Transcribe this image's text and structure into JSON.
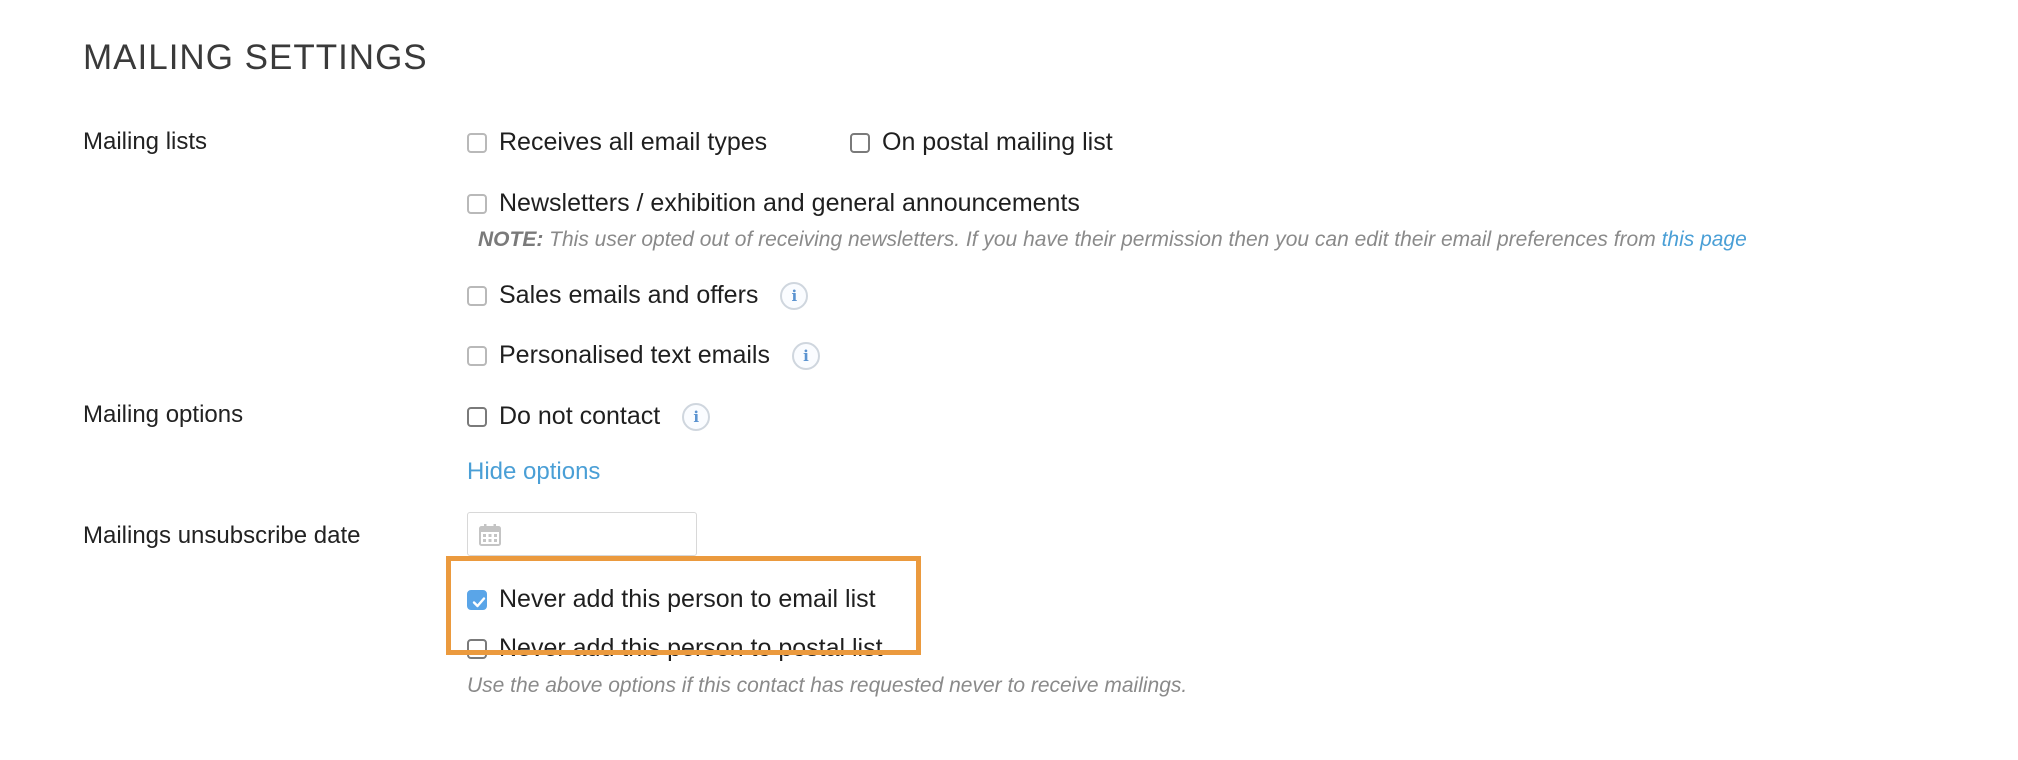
{
  "section_title": "MAILING SETTINGS",
  "mailing_lists": {
    "label": "Mailing lists",
    "receives_all": {
      "label": "Receives all email types",
      "checked": false
    },
    "postal": {
      "label": "On postal mailing list",
      "checked": false
    },
    "newsletters": {
      "label": "Newsletters / exhibition and general announcements",
      "checked": false
    },
    "note": {
      "prefix": "NOTE:",
      "text": " This user opted out of receiving newsletters. If you have their permission then you can edit their email preferences from ",
      "link": "this page"
    },
    "sales": {
      "label": "Sales emails and offers",
      "checked": false,
      "info_icon": "info-icon"
    },
    "personalised": {
      "label": "Personalised text emails",
      "checked": false,
      "info_icon": "info-icon"
    }
  },
  "mailing_options": {
    "label": "Mailing options",
    "do_not_contact": {
      "label": "Do not contact",
      "checked": false,
      "info_icon": "info-icon"
    },
    "hide_options": "Hide options"
  },
  "unsubscribe": {
    "label": "Mailings unsubscribe date",
    "date_value": "",
    "calendar_icon": "calendar-icon",
    "never_email": {
      "label": "Never add this person to email list",
      "checked": true
    },
    "never_postal": {
      "label": "Never add this person to postal list",
      "checked": false
    },
    "help": "Use the above options if this contact has requested never to receive mailings."
  },
  "colors": {
    "accent_link": "#4a9fd6",
    "highlight": "#eb9a3e",
    "checkbox_checked": "#5aa5e8"
  }
}
